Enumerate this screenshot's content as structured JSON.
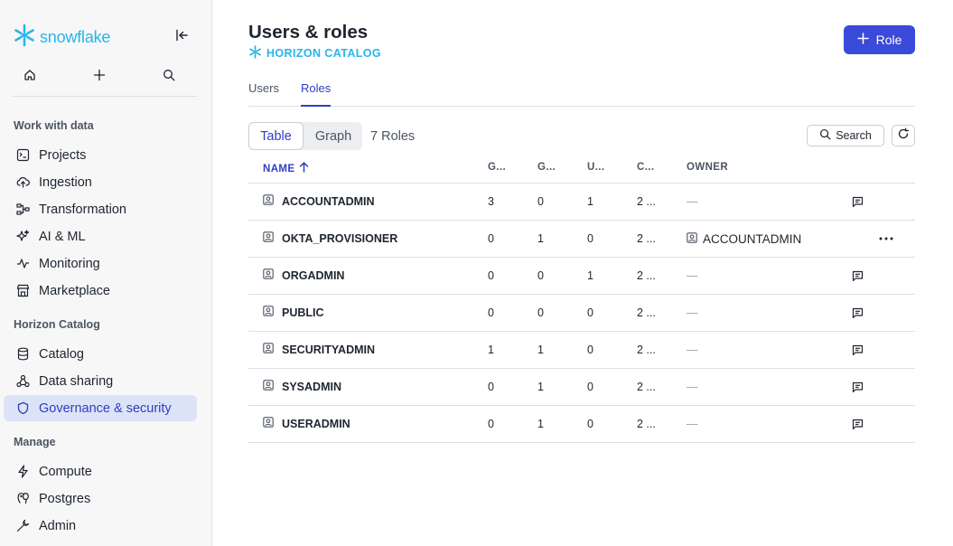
{
  "brand": {
    "name": "snowflake",
    "color": "#29b5e8"
  },
  "sidebar": {
    "sections": [
      {
        "title": "Work with data",
        "items": [
          {
            "label": "Projects",
            "icon": "projects-icon"
          },
          {
            "label": "Ingestion",
            "icon": "ingestion-icon"
          },
          {
            "label": "Transformation",
            "icon": "transformation-icon"
          },
          {
            "label": "AI & ML",
            "icon": "sparkle-icon"
          },
          {
            "label": "Monitoring",
            "icon": "pulse-icon"
          },
          {
            "label": "Marketplace",
            "icon": "marketplace-icon"
          }
        ]
      },
      {
        "title": "Horizon Catalog",
        "items": [
          {
            "label": "Catalog",
            "icon": "database-icon"
          },
          {
            "label": "Data sharing",
            "icon": "share-icon"
          },
          {
            "label": "Governance & security",
            "icon": "shield-icon",
            "active": true
          }
        ]
      },
      {
        "title": "Manage",
        "items": [
          {
            "label": "Compute",
            "icon": "bolt-icon"
          },
          {
            "label": "Postgres",
            "icon": "postgres-icon"
          },
          {
            "label": "Admin",
            "icon": "wrench-icon"
          }
        ]
      }
    ]
  },
  "header": {
    "title": "Users & roles",
    "subtitle": "HORIZON CATALOG",
    "add_button": "Role"
  },
  "tabs": [
    {
      "label": "Users",
      "active": false
    },
    {
      "label": "Roles",
      "active": true
    }
  ],
  "view_toggle": {
    "table": "Table",
    "graph": "Graph",
    "active": "Table"
  },
  "roles_count": "7 Roles",
  "search_label": "Search",
  "table": {
    "columns": [
      "NAME",
      "G...",
      "G...",
      "U...",
      "C...",
      "OWNER"
    ],
    "rows": [
      {
        "name": "ACCOUNTADMIN",
        "c1": "3",
        "c2": "0",
        "c3": "1",
        "c4": "2 ...",
        "owner": "—",
        "action": "comment"
      },
      {
        "name": "OKTA_PROVISIONER",
        "c1": "0",
        "c2": "1",
        "c3": "0",
        "c4": "2 ...",
        "owner": "ACCOUNTADMIN",
        "action": "more"
      },
      {
        "name": "ORGADMIN",
        "c1": "0",
        "c2": "0",
        "c3": "1",
        "c4": "2 ...",
        "owner": "—",
        "action": "comment"
      },
      {
        "name": "PUBLIC",
        "c1": "0",
        "c2": "0",
        "c3": "0",
        "c4": "2 ...",
        "owner": "—",
        "action": "comment"
      },
      {
        "name": "SECURITYADMIN",
        "c1": "1",
        "c2": "1",
        "c3": "0",
        "c4": "2 ...",
        "owner": "—",
        "action": "comment"
      },
      {
        "name": "SYSADMIN",
        "c1": "0",
        "c2": "1",
        "c3": "0",
        "c4": "2 ...",
        "owner": "—",
        "action": "comment"
      },
      {
        "name": "USERADMIN",
        "c1": "0",
        "c2": "1",
        "c3": "0",
        "c4": "2 ...",
        "owner": "—",
        "action": "comment"
      }
    ]
  },
  "colors": {
    "accent": "#3a4ad9",
    "active_nav_bg": "#dde3f7",
    "active_text": "#2e3ec2"
  }
}
